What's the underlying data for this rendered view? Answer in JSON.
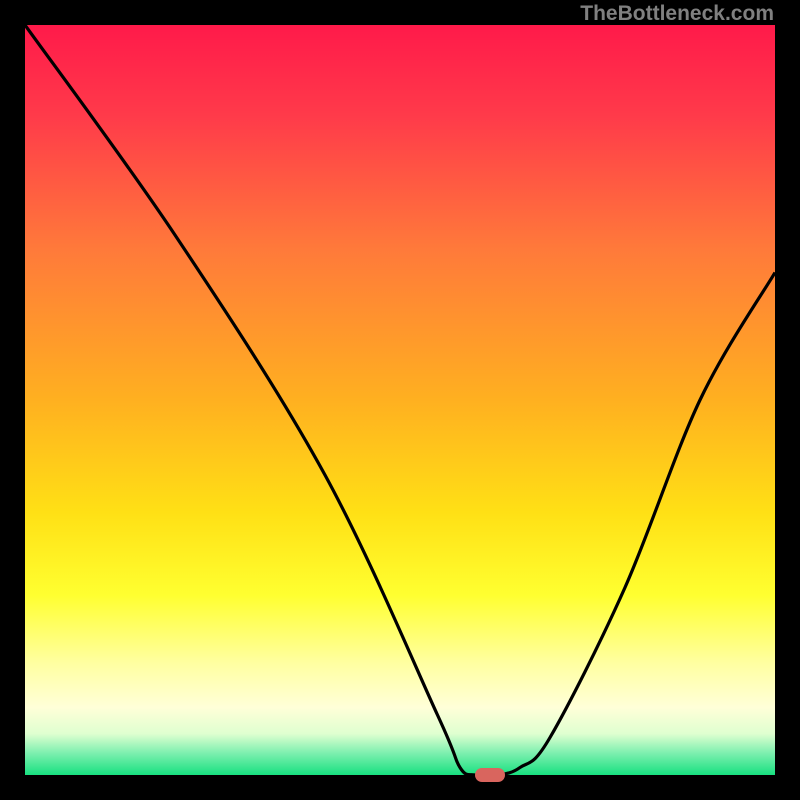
{
  "watermark": "TheBottleneck.com",
  "chart_data": {
    "type": "line",
    "title": "",
    "xlabel": "",
    "ylabel": "",
    "xlim": [
      0,
      100
    ],
    "ylim": [
      0,
      100
    ],
    "series": [
      {
        "name": "bottleneck-curve",
        "x": [
          0,
          20,
          40,
          55,
          58,
          60,
          63,
          66,
          70,
          80,
          90,
          100
        ],
        "y": [
          100,
          72,
          40,
          8,
          1,
          0,
          0,
          1,
          5,
          25,
          50,
          67
        ]
      }
    ],
    "marker": {
      "x": 62,
      "y": 0,
      "color": "#d9655e"
    },
    "gradient_stops": [
      {
        "pos": 0.0,
        "color": "#ff1a4a"
      },
      {
        "pos": 0.12,
        "color": "#ff3a4a"
      },
      {
        "pos": 0.3,
        "color": "#ff7a3a"
      },
      {
        "pos": 0.5,
        "color": "#ffb020"
      },
      {
        "pos": 0.65,
        "color": "#ffe015"
      },
      {
        "pos": 0.76,
        "color": "#ffff30"
      },
      {
        "pos": 0.85,
        "color": "#ffffa0"
      },
      {
        "pos": 0.91,
        "color": "#ffffd8"
      },
      {
        "pos": 0.945,
        "color": "#dfffd0"
      },
      {
        "pos": 0.97,
        "color": "#80f0b0"
      },
      {
        "pos": 1.0,
        "color": "#18e080"
      }
    ]
  }
}
